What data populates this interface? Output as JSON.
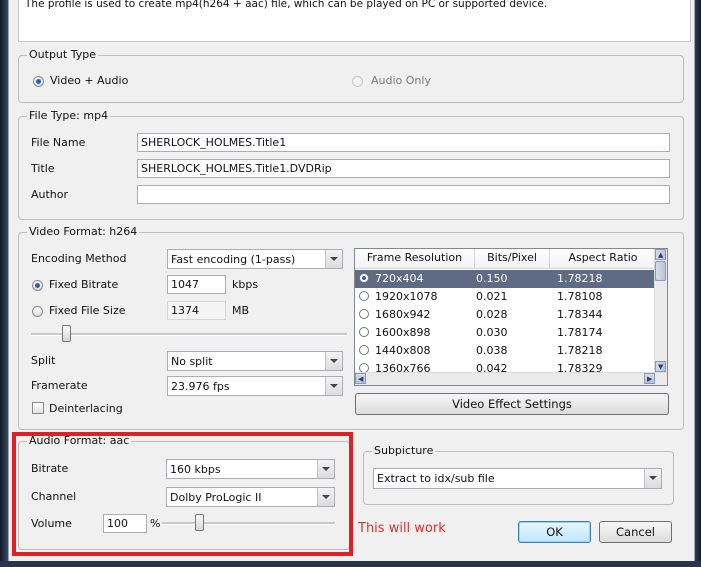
{
  "description": "The profile is used to create mp4(h264 + aac) file, which can be played on PC or supported device.",
  "output_type": {
    "legend": "Output Type",
    "options": [
      {
        "label": "Video + Audio",
        "checked": true
      },
      {
        "label": "Audio Only",
        "checked": false
      }
    ]
  },
  "file_type": {
    "legend": "File Type: mp4",
    "file_name_label": "File Name",
    "file_name_value": "SHERLOCK_HOLMES.Title1",
    "title_label": "Title",
    "title_value": "SHERLOCK_HOLMES.Title1.DVDRip",
    "author_label": "Author",
    "author_value": ""
  },
  "video_format": {
    "legend": "Video Format: h264",
    "encoding_method_label": "Encoding Method",
    "encoding_method_value": "Fast encoding (1-pass)",
    "fixed_bitrate_label": "Fixed Bitrate",
    "fixed_bitrate_value": "1047",
    "fixed_bitrate_unit": "kbps",
    "fixed_file_size_label": "Fixed File Size",
    "fixed_file_size_value": "1374",
    "fixed_file_size_unit": "MB",
    "split_label": "Split",
    "split_value": "No split",
    "framerate_label": "Framerate",
    "framerate_value": "23.976 fps",
    "deinterlacing_label": "Deinterlacing",
    "deinterlacing_checked": false,
    "resolution_table": {
      "headers": [
        "Frame Resolution",
        "Bits/Pixel",
        "Aspect Ratio"
      ],
      "rows": [
        {
          "resolution": "720x404",
          "bits_pixel": "0.150",
          "aspect": "1.78218",
          "selected": true
        },
        {
          "resolution": "1920x1078",
          "bits_pixel": "0.021",
          "aspect": "1.78108",
          "selected": false
        },
        {
          "resolution": "1680x942",
          "bits_pixel": "0.028",
          "aspect": "1.78344",
          "selected": false
        },
        {
          "resolution": "1600x898",
          "bits_pixel": "0.030",
          "aspect": "1.78174",
          "selected": false
        },
        {
          "resolution": "1440x808",
          "bits_pixel": "0.038",
          "aspect": "1.78218",
          "selected": false
        },
        {
          "resolution": "1360x766",
          "bits_pixel": "0.042",
          "aspect": "1.78329",
          "selected": false
        }
      ]
    },
    "video_effect_settings_label": "Video Effect Settings"
  },
  "audio_format": {
    "legend": "Audio Format: aac",
    "bitrate_label": "Bitrate",
    "bitrate_value": "160 kbps",
    "channel_label": "Channel",
    "channel_value": "Dolby ProLogic II",
    "volume_label": "Volume",
    "volume_value": "100",
    "volume_unit": "%"
  },
  "subpicture": {
    "legend": "Subpicture",
    "value": "Extract to idx/sub file"
  },
  "annotation": "This will work",
  "buttons": {
    "ok": "OK",
    "cancel": "Cancel"
  },
  "colors": {
    "highlight": "#e21f25",
    "annotation": "#d9352d",
    "selected_row": "#5f6b82"
  }
}
